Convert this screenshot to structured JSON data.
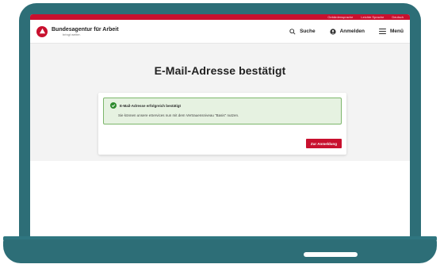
{
  "utility_bar": {
    "items": [
      "Gebärdensprache",
      "Leichte Sprache",
      "Deutsch"
    ]
  },
  "header": {
    "logo_title": "Bundesagentur für Arbeit",
    "logo_subtitle": "bringt weiter.",
    "search_label": "Suche",
    "login_label": "Anmelden",
    "menu_label": "Menü"
  },
  "main": {
    "title": "E-Mail-Adresse bestätigt",
    "alert_title": "E-Mail-Adresse erfolgreich bestätigt",
    "alert_text": "Sie können unsere eServices nun mit dem Vertrauensniveau \"Basis\" nutzen.",
    "cta_label": "Zur Anmeldung"
  },
  "colors": {
    "brand_red": "#c8102e",
    "frame_teal": "#2d6e77",
    "success_green": "#2e8b2e"
  }
}
